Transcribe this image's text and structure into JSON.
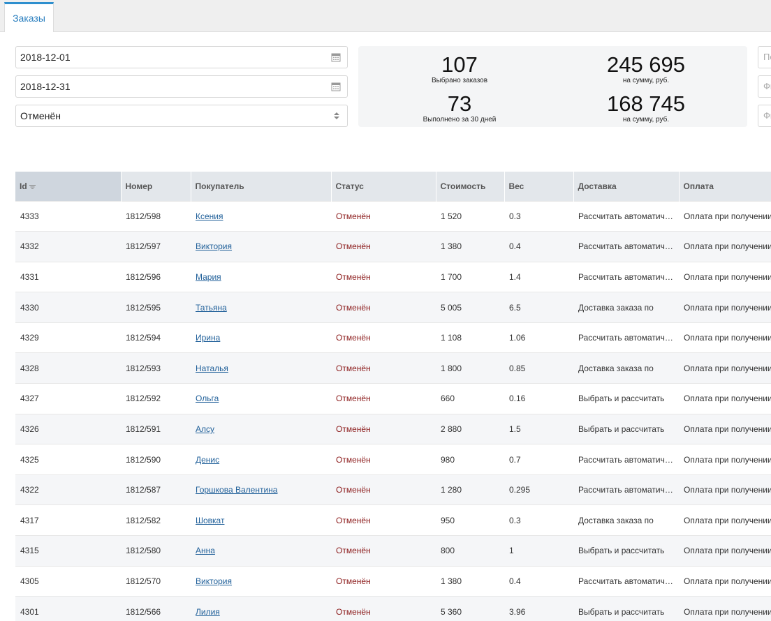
{
  "tabs": [
    {
      "label": "Заказы"
    }
  ],
  "filters": {
    "date_from": "2018-12-01",
    "date_to": "2018-12-31",
    "status": "Отменён"
  },
  "right_fields": [
    "По",
    "Фи",
    "Фи"
  ],
  "stats": {
    "selected_count": "107",
    "selected_label": "Выбрано заказов",
    "selected_sum": "245 695",
    "selected_sum_label": "на сумму, руб.",
    "completed_count": "73",
    "completed_label": "Выполнено за 30 дней",
    "completed_sum": "168 745",
    "completed_sum_label": "на сумму, руб."
  },
  "table": {
    "columns": [
      "Id",
      "Номер",
      "Покупатель",
      "Статус",
      "Стоимость",
      "Вес",
      "Доставка",
      "Оплата"
    ],
    "rows": [
      {
        "id": "4333",
        "number": "1812/598",
        "customer": "Ксения",
        "status": "Отменён",
        "cost": "1 520",
        "weight": "0.3",
        "delivery": "Рассчитать автоматически",
        "payment": "Оплата при получении"
      },
      {
        "id": "4332",
        "number": "1812/597",
        "customer": "Виктория",
        "status": "Отменён",
        "cost": "1 380",
        "weight": "0.4",
        "delivery": "Рассчитать автоматически",
        "payment": "Оплата при получении"
      },
      {
        "id": "4331",
        "number": "1812/596",
        "customer": "Мария",
        "status": "Отменён",
        "cost": "1 700",
        "weight": "1.4",
        "delivery": "Рассчитать автоматически",
        "payment": "Оплата при получении"
      },
      {
        "id": "4330",
        "number": "1812/595",
        "customer": "Татьяна",
        "status": "Отменён",
        "cost": "5 005",
        "weight": "6.5",
        "delivery": "Доставка заказа по",
        "payment": "Оплата при получении"
      },
      {
        "id": "4329",
        "number": "1812/594",
        "customer": "Ирина",
        "status": "Отменён",
        "cost": "1 108",
        "weight": "1.06",
        "delivery": "Рассчитать автоматически",
        "payment": "Оплата при получении"
      },
      {
        "id": "4328",
        "number": "1812/593",
        "customer": "Наталья",
        "status": "Отменён",
        "cost": "1 800",
        "weight": "0.85",
        "delivery": "Доставка заказа по",
        "payment": "Оплата при получении"
      },
      {
        "id": "4327",
        "number": "1812/592",
        "customer": "Ольга",
        "status": "Отменён",
        "cost": "660",
        "weight": "0.16",
        "delivery": "Выбрать и рассчитать",
        "payment": "Оплата при получении"
      },
      {
        "id": "4326",
        "number": "1812/591",
        "customer": "Алсу",
        "status": "Отменён",
        "cost": "2 880",
        "weight": "1.5",
        "delivery": "Выбрать и рассчитать",
        "payment": "Оплата при получении"
      },
      {
        "id": "4325",
        "number": "1812/590",
        "customer": "Денис",
        "status": "Отменён",
        "cost": "980",
        "weight": "0.7",
        "delivery": "Рассчитать автоматически",
        "payment": "Оплата при получении"
      },
      {
        "id": "4322",
        "number": "1812/587",
        "customer": "Горшкова Валентина",
        "status": "Отменён",
        "cost": "1 280",
        "weight": "0.295",
        "delivery": "Рассчитать автоматически",
        "payment": "Оплата при получении"
      },
      {
        "id": "4317",
        "number": "1812/582",
        "customer": "Шовкат",
        "status": "Отменён",
        "cost": "950",
        "weight": "0.3",
        "delivery": "Доставка заказа по",
        "payment": "Оплата при получении"
      },
      {
        "id": "4315",
        "number": "1812/580",
        "customer": "Анна",
        "status": "Отменён",
        "cost": "800",
        "weight": "1",
        "delivery": "Выбрать и рассчитать",
        "payment": "Оплата при получении"
      },
      {
        "id": "4305",
        "number": "1812/570",
        "customer": "Виктория",
        "status": "Отменён",
        "cost": "1 380",
        "weight": "0.4",
        "delivery": "Рассчитать автоматически",
        "payment": "Оплата при получении"
      },
      {
        "id": "4301",
        "number": "1812/566",
        "customer": "Лилия",
        "status": "Отменён",
        "cost": "5 360",
        "weight": "3.96",
        "delivery": "Выбрать и рассчитать",
        "payment": "Оплата при получении"
      }
    ]
  }
}
